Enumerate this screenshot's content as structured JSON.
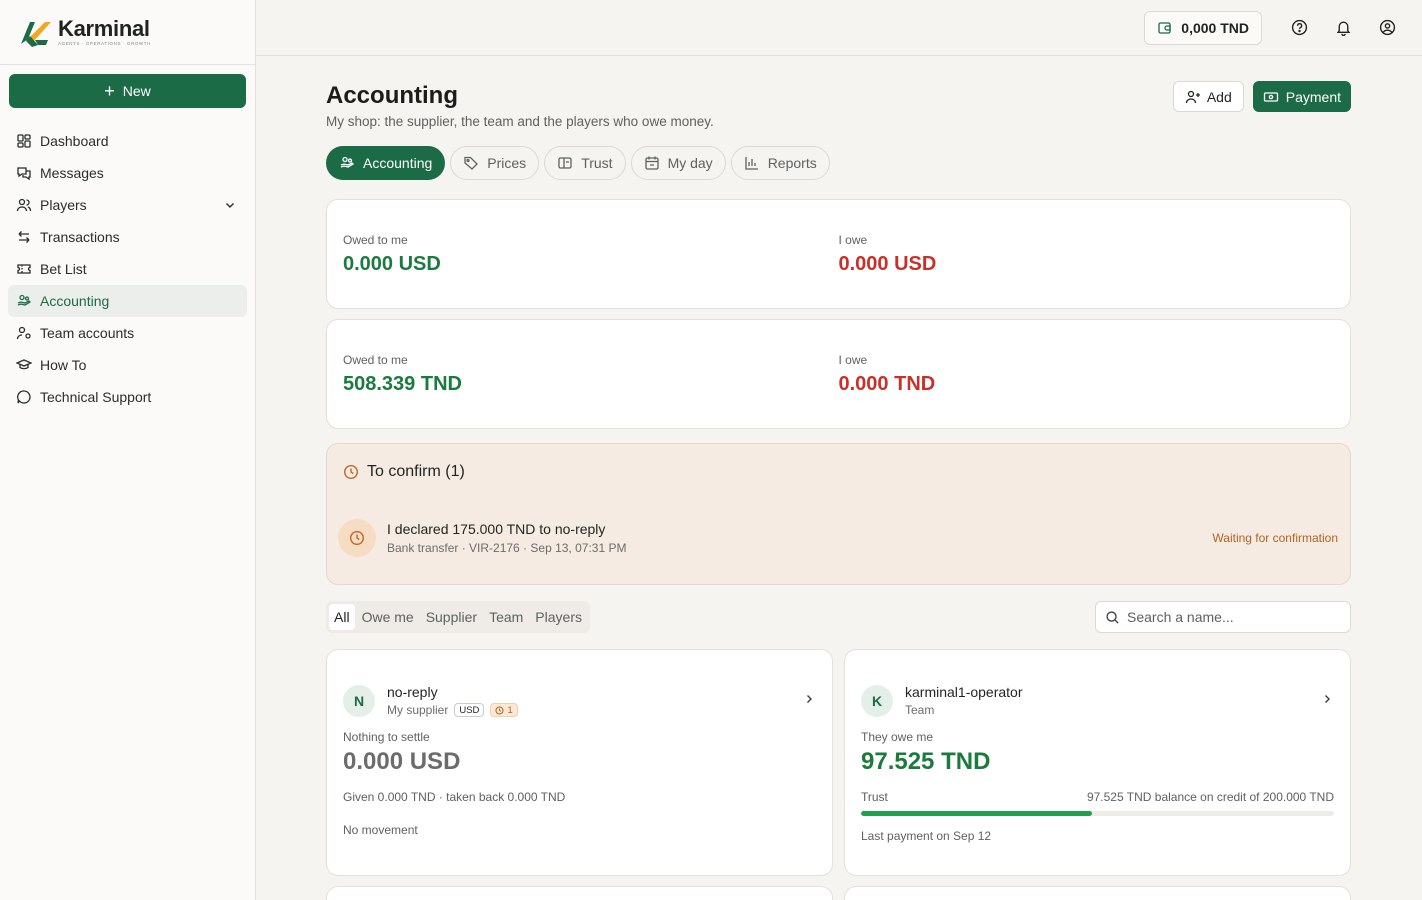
{
  "brand": {
    "name": "Karminal",
    "tagline": "AGENTS · OPERATIONS · GROWTH"
  },
  "sidebar": {
    "new_label": "New",
    "items": [
      {
        "label": "Dashboard",
        "icon": "dashboard-icon"
      },
      {
        "label": "Messages",
        "icon": "messages-icon"
      },
      {
        "label": "Players",
        "icon": "players-icon"
      },
      {
        "label": "Transactions",
        "icon": "transactions-icon"
      },
      {
        "label": "Bet List",
        "icon": "ticket-icon"
      },
      {
        "label": "Accounting",
        "icon": "accounting-icon",
        "active": true
      },
      {
        "label": "Team accounts",
        "icon": "team-icon"
      },
      {
        "label": "How To",
        "icon": "graduation-cap-icon"
      },
      {
        "label": "Technical Support",
        "icon": "support-icon"
      }
    ]
  },
  "topbar": {
    "balance": "0,000 TND"
  },
  "page": {
    "title": "Accounting",
    "subtitle": "My shop: the supplier, the team and the players who owe money.",
    "add_label": "Add",
    "payment_label": "Payment"
  },
  "tabs": [
    "Accounting",
    "Prices",
    "Trust",
    "My day",
    "Reports"
  ],
  "balances": [
    {
      "owed_label": "Owed to me",
      "owed_value": "0.000 USD",
      "owe_label": "I owe",
      "owe_value": "0.000 USD"
    },
    {
      "owed_label": "Owed to me",
      "owed_value": "508.339 TND",
      "owe_label": "I owe",
      "owe_value": "0.000 TND"
    }
  ],
  "confirm": {
    "heading": "To confirm (1)",
    "title": "I declared 175.000 TND to no-reply",
    "meta": "Bank transfer · VIR-2176 · Sep 13, 07:31 PM",
    "status": "Waiting for confirmation"
  },
  "filters": [
    "All",
    "Owe me",
    "Supplier",
    "Team",
    "Players"
  ],
  "search": {
    "placeholder": "Search a name..."
  },
  "cards": [
    {
      "initial": "N",
      "name": "no-reply",
      "role": "My supplier",
      "currency_badge": "USD",
      "pending_badge": "1",
      "label": "Nothing to settle",
      "amount": "0.000 USD",
      "meta": "Given 0.000 TND · taken back 0.000 TND",
      "meta2": "No movement"
    },
    {
      "initial": "K",
      "name": "karminal1-operator",
      "role": "Team",
      "label": "They owe me",
      "amount": "97.525 TND",
      "trust_label": "Trust",
      "trust_text": "97.525 TND balance on credit of 200.000 TND",
      "trust_fraction": 0.4876,
      "foot": "Last payment on Sep 12"
    }
  ],
  "colors": {
    "primary": "#1b6b46",
    "positive": "#1b7a3e",
    "negative": "#c8312a",
    "pending": "#b0651d"
  }
}
